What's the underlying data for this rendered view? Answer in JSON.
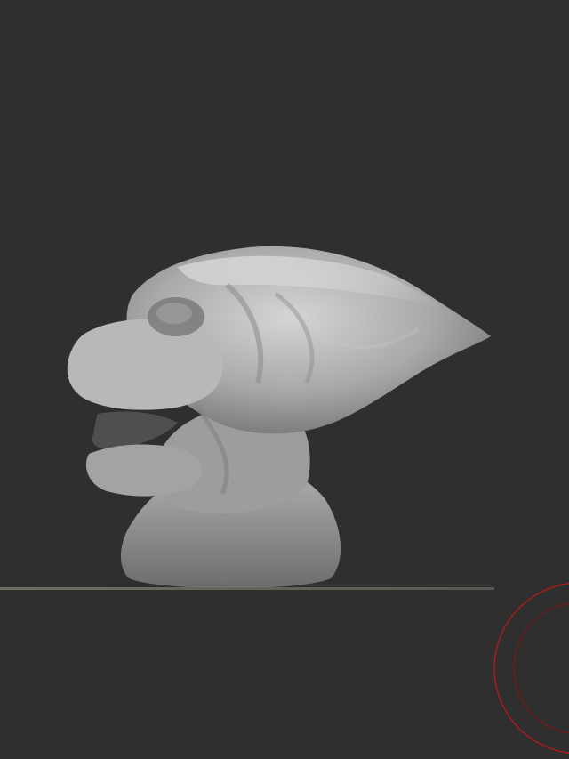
{
  "viewport": {
    "background_color": "#2f2f2f",
    "model": {
      "icon": "sculpted-creature-bust-icon",
      "material_color": "#a8a8a8"
    },
    "floor_grid": {
      "icon": "floor-grid-line-icon",
      "color": "#6f7a63"
    },
    "navigation_gizmo": {
      "icon": "rotation-gizmo-icon",
      "color": "#b11b1b"
    }
  }
}
